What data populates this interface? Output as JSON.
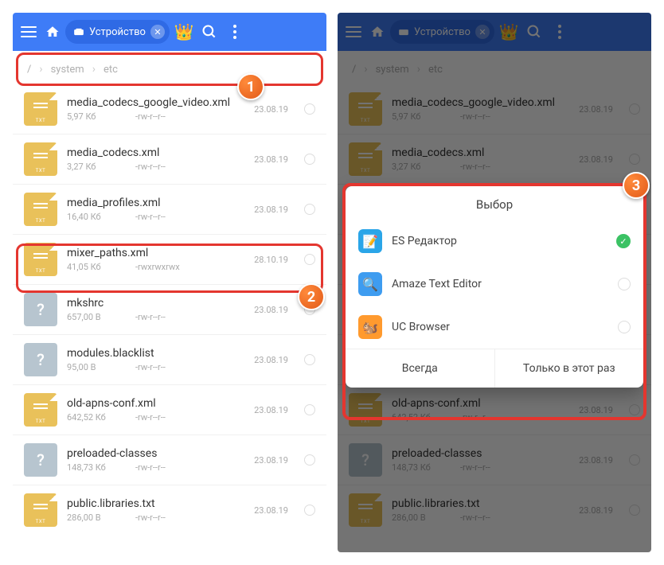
{
  "topbar": {
    "tab_label": "Устройство"
  },
  "breadcrumb": {
    "root": "/",
    "seg1": "system",
    "seg2": "etc"
  },
  "files": [
    {
      "name": "media_codecs_google_video.xml",
      "size": "5,97 Кб",
      "perm": "-rw-r--r--",
      "date": "23.08.19",
      "icon": "txt"
    },
    {
      "name": "media_codecs.xml",
      "size": "3,27 Кб",
      "perm": "-rw-r--r--",
      "date": "23.08.19",
      "icon": "txt"
    },
    {
      "name": "media_profiles.xml",
      "size": "16,40 Кб",
      "perm": "-rw-r--r--",
      "date": "23.08.19",
      "icon": "txt"
    },
    {
      "name": "mixer_paths.xml",
      "size": "41,05 Кб",
      "perm": "-rwxrwxrwx",
      "date": "28.10.19",
      "icon": "txt"
    },
    {
      "name": "mkshrc",
      "size": "657,00 B",
      "perm": "-rw-r--r--",
      "date": "23.08.19",
      "icon": "unk"
    },
    {
      "name": "modules.blacklist",
      "size": "95,00 B",
      "perm": "-rw-r--r--",
      "date": "23.08.19",
      "icon": "unk"
    },
    {
      "name": "old-apns-conf.xml",
      "size": "642,52 Кб",
      "perm": "-rw-r--r--",
      "date": "23.08.19",
      "icon": "txt"
    },
    {
      "name": "preloaded-classes",
      "size": "148,73 Кб",
      "perm": "-rw-r--r--",
      "date": "23.08.19",
      "icon": "unk"
    },
    {
      "name": "public.libraries.txt",
      "size": "286,00 B",
      "perm": "-rw-r--r--",
      "date": "23.08.19",
      "icon": "txt"
    }
  ],
  "dialog": {
    "title": "Выбор",
    "options": [
      {
        "label": "ES Редактор",
        "selected": true,
        "icon": "es"
      },
      {
        "label": "Amaze Text Editor",
        "selected": false,
        "icon": "am"
      },
      {
        "label": "UC Browser",
        "selected": false,
        "icon": "uc"
      }
    ],
    "btn_always": "Всегда",
    "btn_once": "Только в этот раз"
  },
  "callouts": {
    "n1": "1",
    "n2": "2",
    "n3": "3"
  }
}
